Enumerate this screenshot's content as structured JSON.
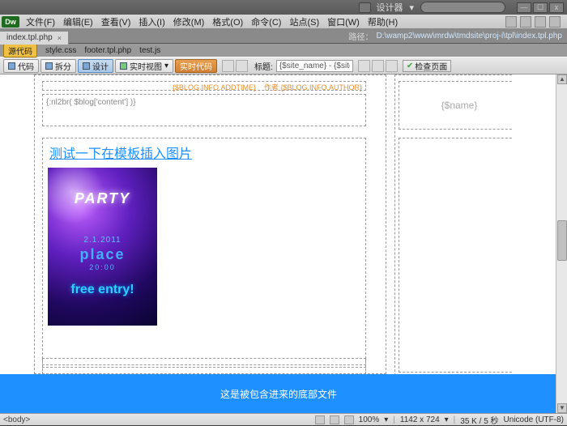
{
  "titlebar": {
    "designer_label": "设计器",
    "min": "—",
    "max": "☐",
    "close": "x"
  },
  "menu": {
    "file": "文件(F)",
    "edit": "编辑(E)",
    "view": "查看(V)",
    "insert": "插入(I)",
    "modify": "修改(M)",
    "format": "格式(O)",
    "commands": "命令(C)",
    "site": "站点(S)",
    "window": "窗口(W)",
    "help": "帮助(H)"
  },
  "doc": {
    "tab": "index.tpl.php",
    "close_x": "×",
    "path_label": "路径：",
    "path": "D:\\wamp2\\www\\mrdw\\tmdsite\\proj-i\\tpl\\index.tpl.php"
  },
  "filebar": {
    "source": "源代码",
    "f1": "style.css",
    "f2": "footer.tpl.php",
    "f3": "test.js"
  },
  "toolbar": {
    "code": "代码",
    "split": "拆分",
    "design": "设计",
    "live": "实时视图",
    "live_code": "实时代码",
    "title_label": "标题:",
    "title_val": "{$site_name} - {$site_int",
    "check": "检查页面"
  },
  "content": {
    "addtime": "{$BLOG.INFO.ADDTIME}",
    "author": "作者 {$BLOG.INFO.AUTHOR}",
    "nl2br": "{:nl2br( $blog['content'] )}",
    "heading": "测试一下在模板插入图片",
    "name_var": "{$name}",
    "poster": {
      "party": "PARTY",
      "date": "2.1.2011",
      "place": "place",
      "time": "20:00",
      "free": "free entry!"
    },
    "footer": "这是被包含进来的底部文件"
  },
  "status": {
    "tag": "<body>",
    "zoom": "100%",
    "dims": "1142 x 724",
    "size": "35 K / 5 秒",
    "enc": "Unicode (UTF-8)"
  }
}
